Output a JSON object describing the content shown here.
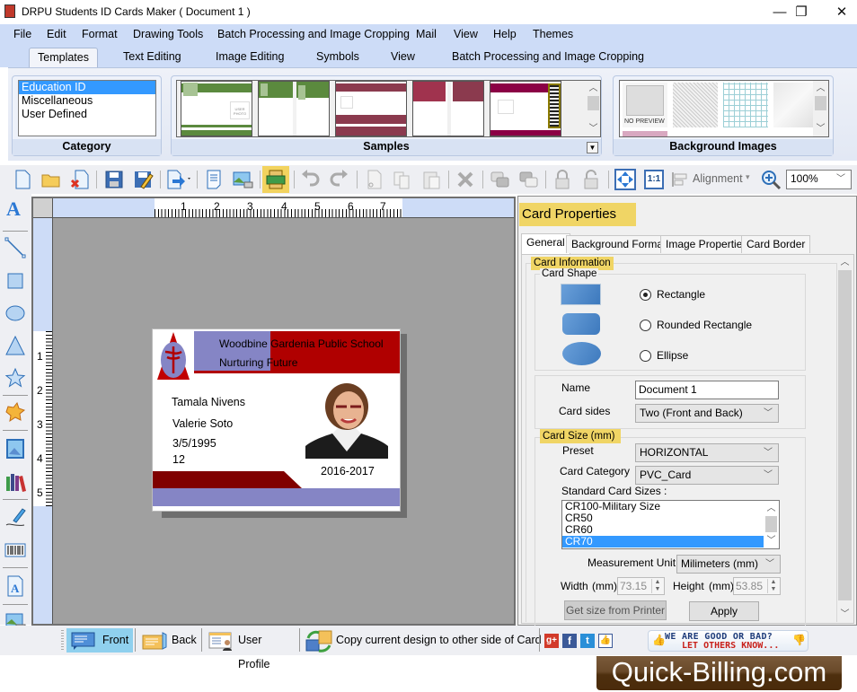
{
  "window": {
    "title": "DRPU Students ID Cards Maker ( Document 1 )",
    "controls": {
      "minimize": "—",
      "restore": "❐",
      "close": "✕"
    }
  },
  "menu": [
    "File",
    "Edit",
    "Format",
    "Drawing Tools",
    "Batch Processing and Image Cropping",
    "Mail",
    "View",
    "Help",
    "Themes"
  ],
  "ribbon_tabs": [
    "Templates",
    "Text Editing",
    "Image Editing",
    "Symbols",
    "View",
    "Batch Processing and Image Cropping"
  ],
  "ribbon": {
    "category": {
      "label": "Category",
      "items": [
        "Education ID",
        "Miscellaneous",
        "User Defined"
      ],
      "selected": "Education ID"
    },
    "samples": {
      "label": "Samples",
      "thumb_text": "USER PHOTO"
    },
    "background_images": {
      "label": "Background Images",
      "no_preview": "NO PREVIEW"
    }
  },
  "toolbar": {
    "alignment_label": "Alignment",
    "zoom_value": "100%",
    "one_to_one": "1:1"
  },
  "ruler": {
    "horizontal": [
      "1",
      "2",
      "3",
      "4",
      "5",
      "6",
      "7"
    ],
    "vertical": [
      "1",
      "2",
      "3",
      "4",
      "5"
    ]
  },
  "card": {
    "school_name": "Woodbine Gardenia Public School",
    "tagline": "Nurturing Future",
    "name": "Tamala Nivens",
    "parent": "Valerie Soto",
    "dob": "3/5/1995",
    "class": "12",
    "session": "2016-2017",
    "colors": {
      "red": "#b00000",
      "darkred": "#800000",
      "lavender": "#8585c5"
    }
  },
  "properties": {
    "title": "Card Properties",
    "tabs": [
      "General",
      "Background Format",
      "Image Properties",
      "Card Border"
    ],
    "active_tab": "General",
    "card_information_label": "Card Information",
    "card_shape_label": "Card Shape",
    "shapes": [
      {
        "label": "Rectangle",
        "selected": true
      },
      {
        "label": "Rounded Rectangle",
        "selected": false
      },
      {
        "label": "Ellipse",
        "selected": false
      }
    ],
    "name_label": "Name",
    "name_value": "Document 1",
    "card_sides_label": "Card sides",
    "card_sides_value": "Two (Front and Back)",
    "card_size_label": "Card Size (mm)",
    "preset_label": "Preset",
    "preset_value": "HORIZONTAL",
    "card_category_label": "Card Category",
    "card_category_value": "PVC_Card",
    "standard_sizes_label": "Standard Card Sizes :",
    "standard_sizes": [
      "CR100-Military Size",
      "CR50",
      "CR60",
      "CR70"
    ],
    "standard_selected": "CR70",
    "measurement_unit_label": "Measurement Unit :",
    "measurement_unit_value": "Milimeters (mm)",
    "width_label": "Width",
    "width_unit": "(mm)",
    "width_value": "73.15",
    "height_label": "Height",
    "height_unit": "(mm)",
    "height_value": "53.85",
    "get_size_button": "Get size from Printer",
    "apply_button": "Apply"
  },
  "bottombar": {
    "front": "Front",
    "back": "Back",
    "user_profile": "User Profile",
    "copy_design": "Copy current design to other side of Card",
    "feedback_line1": "WE ARE GOOD OR BAD?",
    "feedback_line2": "LET OTHERS KNOW..."
  },
  "watermark": "Quick-Billing.com"
}
